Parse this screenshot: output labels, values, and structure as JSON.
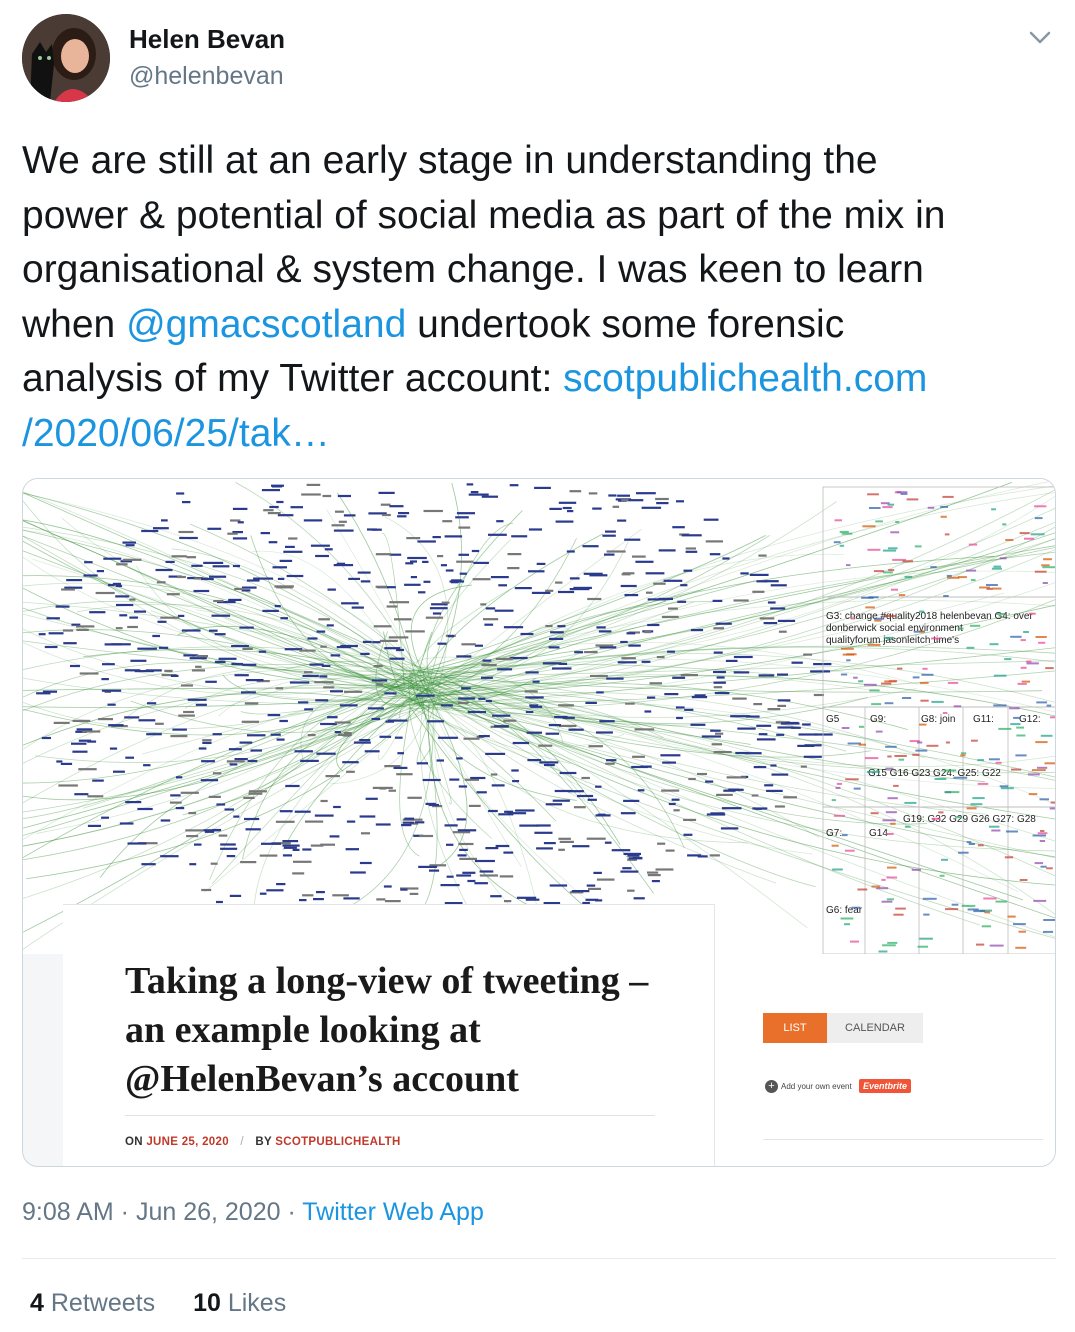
{
  "tweet": {
    "author": {
      "name": "Helen Bevan",
      "handle": "@helenbevan"
    },
    "text_before_mention": "We are still at an early stage in understanding the\npower & potential of social media as part of the mix in\norganisational & system change. I was keen to learn\nwhen ",
    "mention": "@gmacscotland",
    "text_after_mention": "  undertook some forensic\nanalysis of my Twitter account: ",
    "link": "scotpublichealth.com\n/2020/06/25/tak…",
    "timestamp": "9:08 AM · Jun 26, 2020 · ",
    "source": "Twitter Web App",
    "retweets": {
      "count": "4",
      "label": "Retweets"
    },
    "likes": {
      "count": "10",
      "label": "Likes"
    }
  },
  "card": {
    "network_labels": {
      "g3": "G3: change #quality2018 helenbevan G4: over",
      "g3b": "donberwick social environment",
      "g3c": "qualityforum jasonleitch time's",
      "g5": "G5",
      "g9": "G9:",
      "g8": "G8: join",
      "g11": "G11:",
      "g12": "G12:",
      "g7": "G7:",
      "g14": "G14",
      "g19": "G19: G32 G29 G26 G27: G28",
      "g15": "G15 G16 G23 G24: G25: G22",
      "g6": "G6: fear"
    },
    "article": {
      "title": "Taking a long-view of tweeting – an example looking at @HelenBevan’s account",
      "on_label": "ON",
      "date": "JUNE 25, 2020",
      "separator": "/",
      "by_label": "BY",
      "author": "SCOTPUBLICHEALTH"
    },
    "sidebar": {
      "tab_list": "LIST",
      "tab_calendar": "CALENDAR",
      "add_event": "Add your own event",
      "eventbrite": "Eventbrite"
    }
  },
  "colors": {
    "link": "#1b95e0",
    "network_green": "#2e8b2e",
    "node_blue": "#2a3a8c",
    "tab_orange": "#e8702a"
  }
}
